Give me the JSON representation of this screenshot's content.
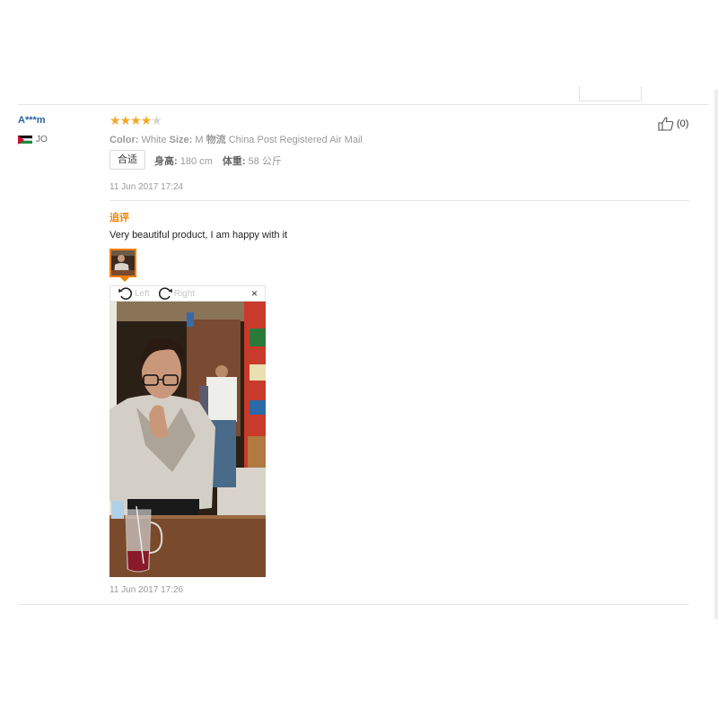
{
  "review": {
    "user": "A***m",
    "country_code": "JO",
    "rating": 4,
    "rating_max": 5,
    "color_label": "Color:",
    "color_value": "White",
    "size_label": "Size:",
    "size_value": "M",
    "shipping_label": "物流",
    "shipping_value": "China Post Registered Air Mail",
    "fit_tag": "合适",
    "height_label": "身高:",
    "height_value": "180 cm",
    "weight_label": "体重:",
    "weight_value": "58 公斤",
    "date": "11 Jun 2017 17:24",
    "helpful_count": "(0)"
  },
  "followup": {
    "title": "追评",
    "text": "Very beautiful product, I am happy with it",
    "date": "11 Jun 2017 17:26"
  },
  "viewer": {
    "rotate_left_label": "Left",
    "rotate_right_label": "Right",
    "close_label": "×"
  },
  "icons": {
    "star": "star-icon",
    "like": "thumbs-up-icon",
    "rotate_left": "rotate-left-icon",
    "rotate_right": "rotate-right-icon",
    "close": "close-icon"
  },
  "colors": {
    "username": "#2a62a8",
    "star": "#f5a623",
    "accent": "#f08000"
  }
}
